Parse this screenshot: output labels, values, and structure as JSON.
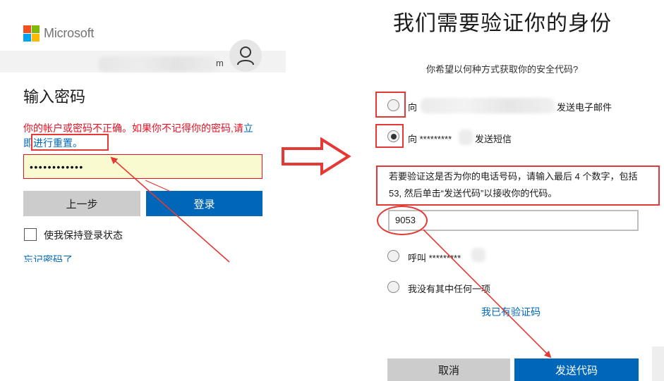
{
  "left_panel": {
    "brand": "Microsoft",
    "email_suffix": "m",
    "heading": "输入密码",
    "error_text": "你的帐户或密码不正确。如果你不记得你的密码,请",
    "error_link": "立即进行重置。",
    "password_mask": "••••••••••••",
    "back_button": "上一步",
    "signin_button": "登录",
    "keep_signed_in": "使我保持登录状态",
    "forgot_password": "忘记密码了"
  },
  "right_panel": {
    "heading": "我们需要验证你的身份",
    "question": "你希望以何种方式获取你的安全代码?",
    "options": [
      {
        "prefix": "向",
        "suffix": "发送电子邮件",
        "selected": false
      },
      {
        "prefix": "向 *********",
        "suffix": "发送短信",
        "selected": true
      },
      {
        "prefix": "呼叫 *********",
        "suffix": "",
        "selected": false
      },
      {
        "prefix": "我没有其中任何一项",
        "suffix": "",
        "selected": false
      }
    ],
    "instruction": "若要验证这是否为你的电话号码，请输入最后 4 个数字，包括 53, 然后单击“发送代码”以接收你的代码。",
    "code_value": "9053",
    "have_code_link": "我已有验证码",
    "cancel_button": "取消",
    "send_button": "发送代码"
  },
  "colors": {
    "accent_blue": "#0067b8",
    "error_red": "#e81123",
    "annotation_red": "#e53935",
    "ms_red": "#f25022",
    "ms_green": "#7fba00",
    "ms_blue": "#00a4ef",
    "ms_yellow": "#ffb900"
  },
  "icons": {
    "avatar": "person-icon",
    "transition": "right-arrow-icon"
  }
}
